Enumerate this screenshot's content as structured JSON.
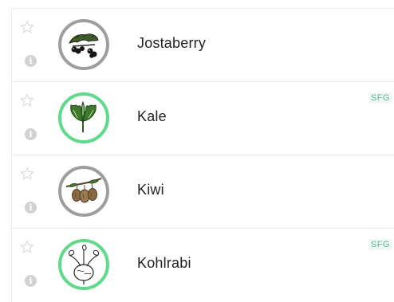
{
  "plants": [
    {
      "name": "Jostaberry",
      "badge": "",
      "icon": "jostaberry-icon",
      "accent": "#9e9e9e"
    },
    {
      "name": "Kale",
      "badge": "SFG",
      "icon": "kale-icon",
      "accent": "#5fd98a"
    },
    {
      "name": "Kiwi",
      "badge": "",
      "icon": "kiwi-icon",
      "accent": "#9e9e9e"
    },
    {
      "name": "Kohlrabi",
      "badge": "SFG",
      "icon": "kohlrabi-icon",
      "accent": "#5fd98a"
    }
  ],
  "info_glyph": "i",
  "colors": {
    "sfg_border": "#5fd98a",
    "default_border": "#9e9e9e",
    "badge_text": "#4cba9a",
    "icon_muted": "#d2d2d2"
  }
}
